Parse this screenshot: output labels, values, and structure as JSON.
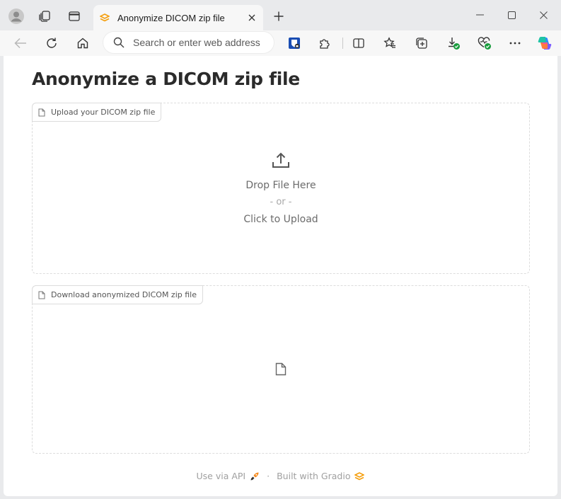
{
  "browser": {
    "tab": {
      "title": "Anonymize DICOM zip file"
    },
    "address_bar": {
      "placeholder": "Search or enter web address"
    }
  },
  "page": {
    "title": "Anonymize a DICOM zip file",
    "upload": {
      "label": "Upload your DICOM zip file",
      "drop_text": "Drop File Here",
      "or_text": "- or -",
      "click_text": "Click to Upload"
    },
    "download": {
      "label": "Download anonymized DICOM zip file"
    },
    "footer": {
      "api_text": "Use via API",
      "separator": "·",
      "built_text": "Built with Gradio"
    }
  },
  "colors": {
    "gradio_orange": "#f59e0b",
    "copilot_accent": "#7c5cff",
    "status_green": "#1a9c3e",
    "browser_frame": "#e9eaec"
  }
}
